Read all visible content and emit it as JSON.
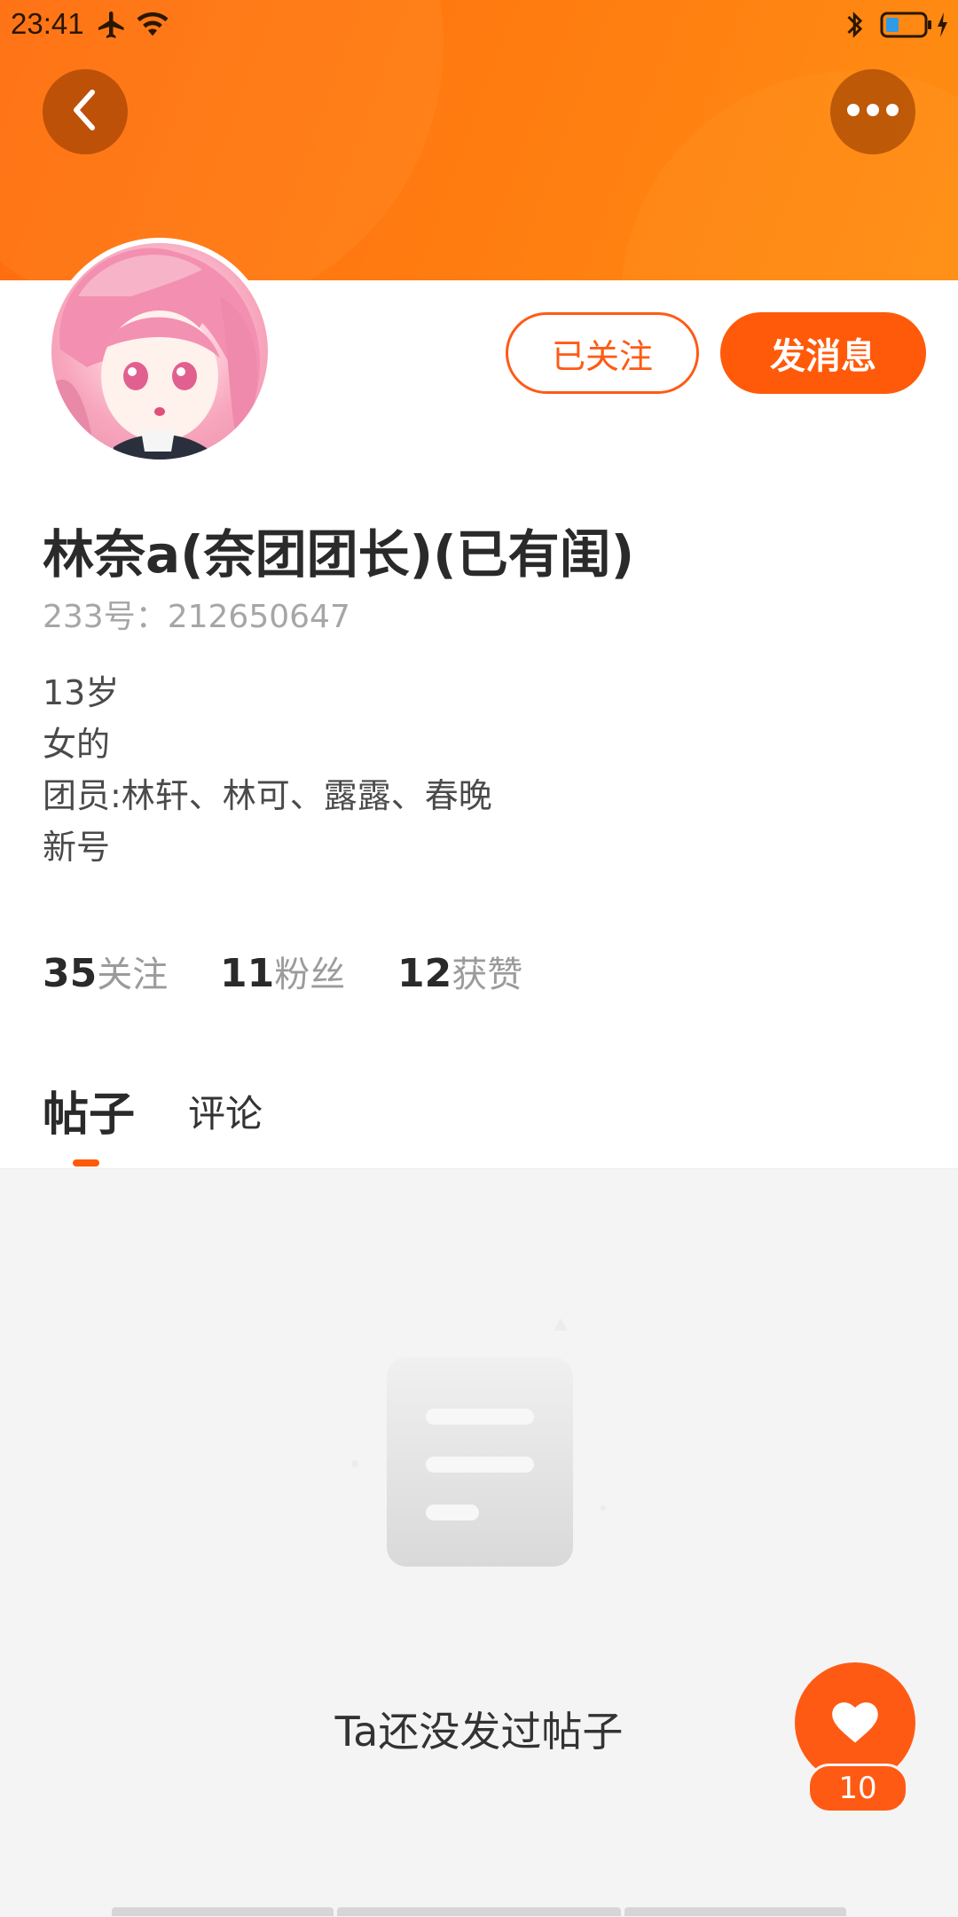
{
  "status_bar": {
    "time": "23:41",
    "icons": [
      "airplane-icon",
      "wifi-icon",
      "bluetooth-icon",
      "battery-icon",
      "charging-icon"
    ]
  },
  "header": {
    "back_icon": "chevron-left-icon",
    "more_icon": "more-dots-icon",
    "banner_color": "#ff7a10"
  },
  "profile": {
    "follow_button_label": "已关注",
    "message_button_label": "发消息",
    "name": "林奈a(奈团团长)(已有闺)",
    "id_line": "233号：212650647",
    "bio_lines": [
      "13岁",
      "女的",
      "团员:林轩、林可、露露、春晚",
      "新号"
    ]
  },
  "stats": [
    {
      "value": "35",
      "label": "关注"
    },
    {
      "value": "11",
      "label": "粉丝"
    },
    {
      "value": "12",
      "label": "获赞"
    }
  ],
  "tabs": [
    {
      "label": "帖子",
      "active": true
    },
    {
      "label": "评论",
      "active": false
    }
  ],
  "empty_state": {
    "icon": "empty-document-icon",
    "text": "Ta还没发过帖子"
  },
  "like_button": {
    "icon": "heart-icon",
    "count": "10"
  },
  "accent_color": "#ff5a0a"
}
